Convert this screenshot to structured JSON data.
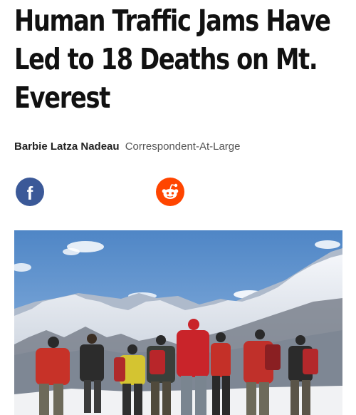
{
  "article": {
    "headline": "Human Traffic Jams Have Led to 18 Deaths on Mt. Everest",
    "author": "Barbie Latza Nadeau",
    "author_role": "Correspondent-At-Large"
  },
  "share": {
    "facebook_icon": "facebook-icon",
    "reddit_icon": "reddit-icon",
    "facebook_glyph": "f"
  },
  "hero_image": {
    "subject": "hikers-facing-himalayan-mountains"
  },
  "colors": {
    "facebook": "#3b5998",
    "reddit": "#ff4500",
    "headline": "#111111"
  }
}
